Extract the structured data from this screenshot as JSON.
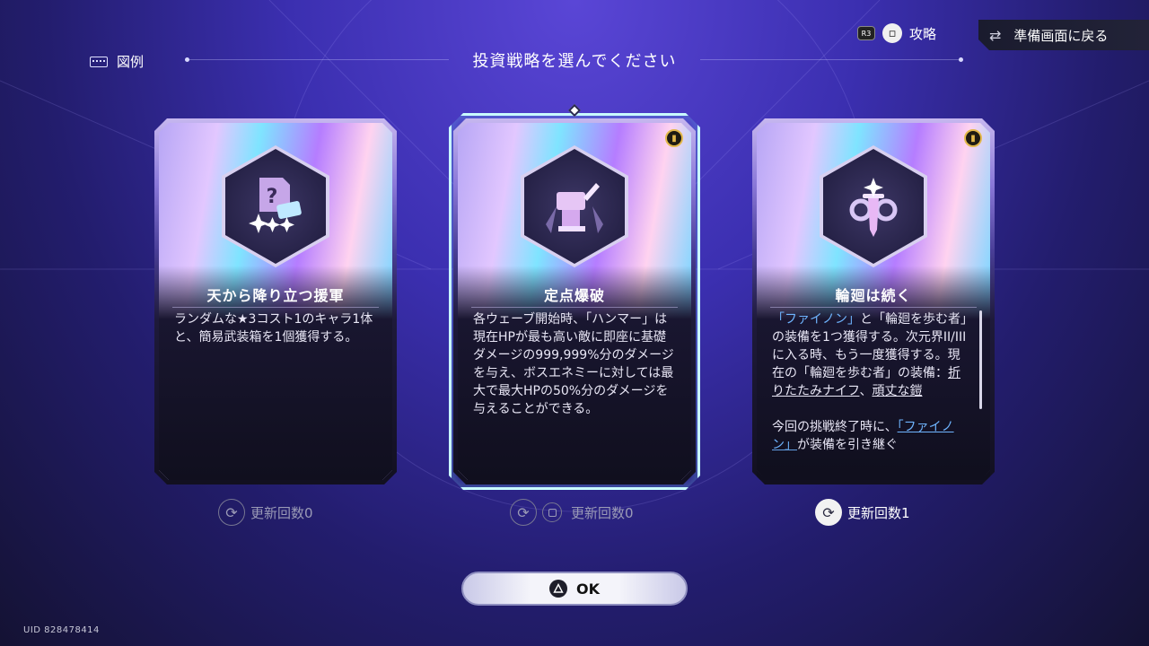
{
  "header": {
    "legend_label": "図例",
    "page_title": "投資戦略を選んでください",
    "guide_label": "攻略",
    "r3_label": "R3",
    "back_label": "準備画面に戻る"
  },
  "cards": [
    {
      "title": "天から降り立つ援軍",
      "description": "ランダムな★3コスト1のキャラ1体と、簡易武装箱を1個獲得する。",
      "icon": "reinforcement-icon",
      "selected": false,
      "refresh_label": "更新回数0"
    },
    {
      "title": "定点爆破",
      "description": "各ウェーブ開始時、「ハンマー」は現在HPが最も高い敵に即座に基礎ダメージの999,999%分のダメージを与え、ボスエネミーに対しては最大で最大HPの50%分のダメージを与えることができる。",
      "icon": "hammer-icon",
      "selected": true,
      "refresh_label": "更新回数0"
    },
    {
      "title": "輪廻は続く",
      "desc_parts": {
        "q1": "「ファイノン」",
        "p1": "と「輪廻を歩む者」の装備を1つ獲得する。次元界II/IIIに入る時、もう一度獲得する。現在の「輪廻を歩む者」の装備：",
        "link1": "折りたたみナイフ",
        "sep": "、",
        "link2": "頑丈な鎧",
        "p2": "今回の挑戦終了時に、",
        "q2": "「ファイノン」",
        "p3": "が装備を引き継ぐ"
      },
      "icon": "sword-icon",
      "selected": false,
      "refresh_label": "更新回数1"
    }
  ],
  "ok_label": "OK",
  "uid": "UID 828478414",
  "colors": {
    "accent_cyan": "#c9fbff",
    "link_blue": "#6fb5ff",
    "badge_gold": "#e2b84a"
  }
}
